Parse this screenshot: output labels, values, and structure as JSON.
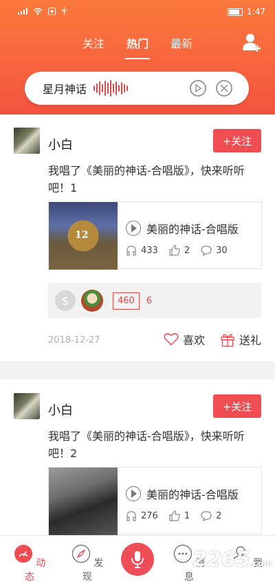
{
  "status": {
    "time": "1:47"
  },
  "tabs": [
    {
      "label": "关注"
    },
    {
      "label": "热门"
    },
    {
      "label": "最新"
    }
  ],
  "search": {
    "text": "星月神话"
  },
  "posts": [
    {
      "user": "小白",
      "follow_label": "+关注",
      "message": "我唱了《美丽的神话-合唱版》，快来听听吧！1",
      "song": {
        "title": "美丽的神话-合唱版",
        "listens": "433",
        "likes": "2",
        "comments": "30",
        "cover_text": "12"
      },
      "gift": {
        "score": "460",
        "count": "6"
      },
      "date": "2018-12-27",
      "like_label": "喜欢",
      "gift_label": "送礼"
    },
    {
      "user": "小白",
      "follow_label": "+关注",
      "message": "我唱了《美丽的神话-合唱版》，快来听听吧！2",
      "song": {
        "title": "美丽的神话-合唱版",
        "listens": "276",
        "likes": "1",
        "comments": "2"
      }
    }
  ],
  "bottom_nav": [
    {
      "label": "动态"
    },
    {
      "label": "发现"
    },
    {
      "label": "消息"
    },
    {
      "label": "我"
    }
  ],
  "watermark": {
    "text": "2265",
    "sub": ".com"
  },
  "colors": {
    "accent": "#ef4d52",
    "header_top": "#fb7a3c",
    "header_bottom": "#f4533f"
  }
}
